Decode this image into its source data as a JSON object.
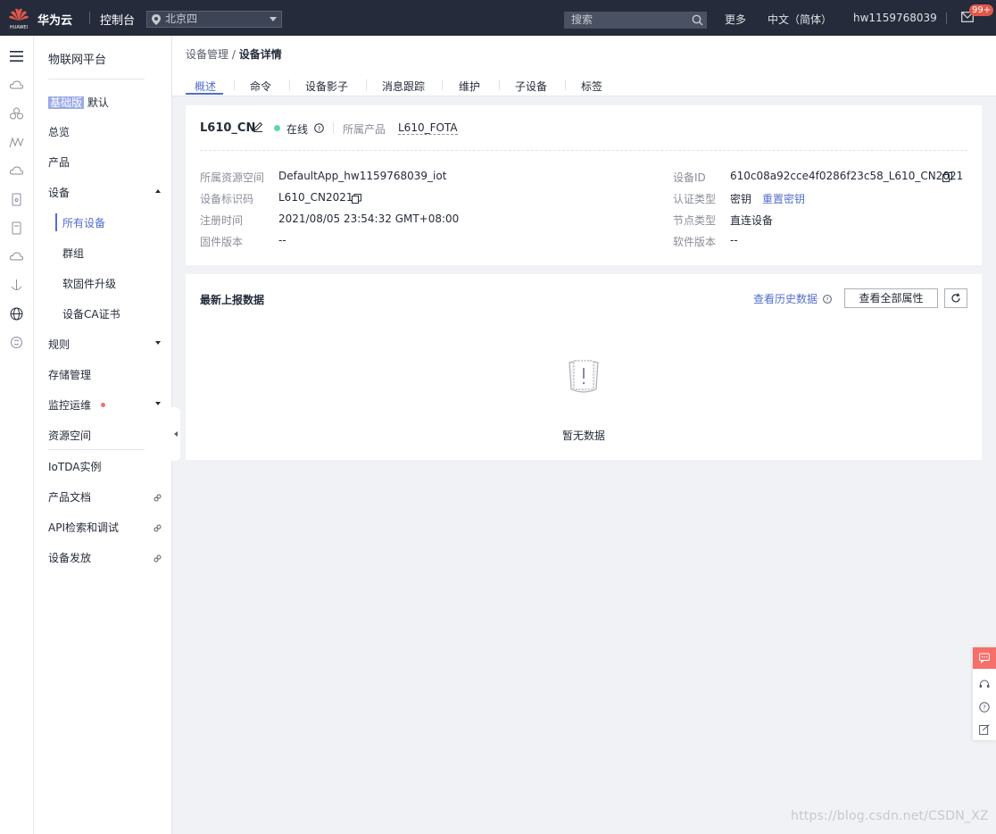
{
  "topbar": {
    "brand_under_logo": "HUAWEI",
    "brand": "华为云",
    "console": "控制台",
    "region": "北京四",
    "search_placeholder": "搜索",
    "more": "更多",
    "language": "中文（简体）",
    "username": "hw1159768039",
    "message_badge": "99+"
  },
  "sidebar": {
    "title": "物联网平台",
    "edition_tag": "基础版",
    "edition_value": "默认",
    "items": [
      {
        "label": "总览"
      },
      {
        "label": "产品"
      },
      {
        "label": "设备"
      },
      {
        "label": "所有设备"
      },
      {
        "label": "群组"
      },
      {
        "label": "软固件升级"
      },
      {
        "label": "设备CA证书"
      },
      {
        "label": "规则"
      },
      {
        "label": "存储管理"
      },
      {
        "label": "监控运维"
      },
      {
        "label": "资源空间"
      },
      {
        "label": "IoTDA实例"
      },
      {
        "label": "产品文档"
      },
      {
        "label": "API检索和调试"
      },
      {
        "label": "设备发放"
      }
    ]
  },
  "breadcrumb": {
    "parent": "设备管理",
    "separator": "/",
    "current": "设备详情"
  },
  "tabs": [
    {
      "label": "概述"
    },
    {
      "label": "命令"
    },
    {
      "label": "设备影子"
    },
    {
      "label": "消息跟踪"
    },
    {
      "label": "维护"
    },
    {
      "label": "子设备"
    },
    {
      "label": "标签"
    }
  ],
  "device": {
    "name": "L610_CN",
    "status": "在线",
    "product_label": "所属产品",
    "product_value": "L610_FOTA",
    "fields": {
      "resource_space_label": "所属资源空间",
      "resource_space_value": "DefaultApp_hw1159768039_iot",
      "identifier_label": "设备标识码",
      "identifier_value": "L610_CN2021",
      "registered_label": "注册时间",
      "registered_value": "2021/08/05 23:54:32 GMT+08:00",
      "firmware_label": "固件版本",
      "firmware_value": "--",
      "device_id_label": "设备ID",
      "device_id_value": "610c08a92cce4f0286f23c58_L610_CN2021",
      "auth_label": "认证类型",
      "auth_value": "密钥",
      "reset_key": "重置密钥",
      "node_label": "节点类型",
      "node_value": "直连设备",
      "software_label": "软件版本",
      "software_value": "--"
    }
  },
  "latest_data": {
    "title": "最新上报数据",
    "history_link": "查看历史数据",
    "all_props_button": "查看全部属性",
    "empty_text": "暂无数据"
  },
  "watermark": "https://blog.csdn.net/CSDN_XZ",
  "colors": {
    "topbar_bg": "#252b3a",
    "accent": "#526ecc",
    "online": "#5ed5b4",
    "alert": "#f66f6a",
    "page_bg": "#f0f2f5"
  }
}
